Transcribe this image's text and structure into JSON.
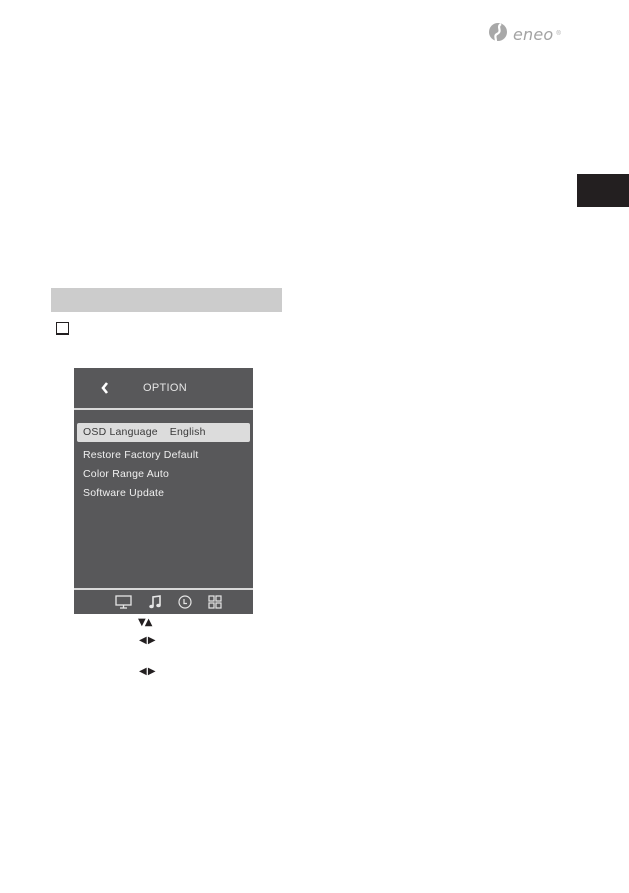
{
  "brand": {
    "name": "eneo",
    "registered_mark": "®"
  },
  "section_bar": {
    "label": ""
  },
  "osd": {
    "title": "OPTION",
    "back_icon": "chevron-left-icon",
    "items": [
      {
        "label": "OSD Language",
        "value": "English",
        "selected": true
      },
      {
        "label": "Restore Factory Default",
        "value": "",
        "selected": false
      },
      {
        "label": "Color Range Auto",
        "value": "",
        "selected": false
      },
      {
        "label": "Software Update",
        "value": "",
        "selected": false
      }
    ],
    "footer_icons": [
      {
        "name": "monitor-icon"
      },
      {
        "name": "music-note-icon"
      },
      {
        "name": "clock-icon"
      },
      {
        "name": "grid-icon"
      }
    ],
    "colors": {
      "panel": "#58585a",
      "highlight": "#dcdcdc",
      "text": "#f0f0f0",
      "separator": "#d9d9d9"
    }
  },
  "instructions": [
    {
      "keys": "▼▲"
    },
    {
      "keys": "◀ ▶"
    },
    {
      "keys": "◀ ▶"
    }
  ],
  "side_tab": {
    "color": "#231f20"
  }
}
